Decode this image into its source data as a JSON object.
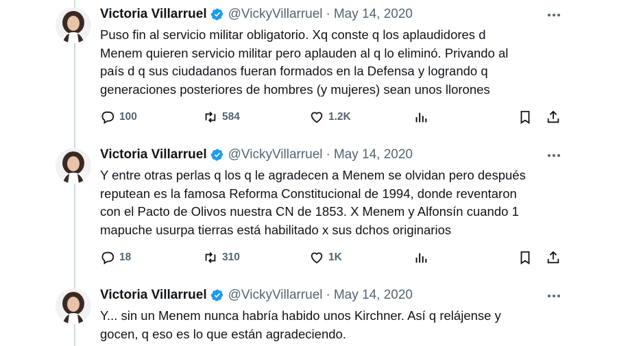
{
  "tweets": [
    {
      "name": "Victoria Villarruel",
      "handle": "@VickyVillarruel",
      "separator": "·",
      "date": "May 14, 2020",
      "text": "Puso fin al servicio militar obligatorio. Xq conste q los aplaudidores d\nMenem quieren servicio militar pero aplauden al q lo eliminó. Privando al\npaís d q sus ciudadanos fueran formados en la Defensa y logrando q\ngeneraciones posteriores de hombres (y mujeres) sean unos llorones",
      "replies": "100",
      "reposts": "584",
      "likes": "1.2K"
    },
    {
      "name": "Victoria Villarruel",
      "handle": "@VickyVillarruel",
      "separator": "·",
      "date": "May 14, 2020",
      "text": "Y entre otras perlas q los q le agradecen a Menem se olvidan pero después\nreputean es la famosa Reforma Constitucional de 1994, donde reventaron\ncon el Pacto de Olivos nuestra CN de 1853. X Menem y Alfonsín cuando 1\nmapuche usurpa tierras está habilitado x sus dchos originarios",
      "replies": "18",
      "reposts": "310",
      "likes": "1K"
    },
    {
      "name": "Victoria Villarruel",
      "handle": "@VickyVillarruel",
      "separator": "·",
      "date": "May 14, 2020",
      "text": "Y... sin un Menem nunca habría habido unos Kirchner. Así q relájense y\ngocen, q eso es lo que están agradeciendo."
    }
  ],
  "icons": {
    "verified": "verified-badge-icon",
    "more": "more-options-icon",
    "reply": "reply-icon",
    "repost": "repost-icon",
    "like": "like-icon",
    "views": "views-icon",
    "bookmark": "bookmark-icon",
    "share": "share-icon"
  },
  "colors": {
    "verified": "#1d9bf0",
    "muted": "#536471",
    "text": "#0f1419",
    "thread_line": "#cfd9de"
  }
}
